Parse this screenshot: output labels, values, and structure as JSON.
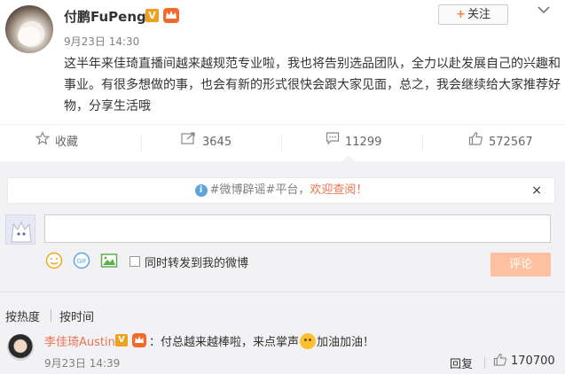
{
  "post": {
    "author": "付鹏FuPeng",
    "verified_badge": "V",
    "follow_label": "关注",
    "follow_plus": "+",
    "time": "9月23日 14:30",
    "content": "这半年来佳琦直播间越来越规范专业啦，我也将告别选品团队，全力以赴发展自己的兴趣和事业。有很多想做的事，也会有新的形式很快会跟大家见面，总之，我会继续给大家推荐好物，分享生活哦"
  },
  "actions": {
    "favorite": "收藏",
    "repost_count": "3645",
    "comment_count": "11299",
    "like_count": "572567"
  },
  "comment_box": {
    "notice_text": "#微博辟谣#平台，",
    "notice_link": "欢迎查阅！",
    "notice_close": "×",
    "repost_label": "同时转发到我的微博",
    "submit_label": "评论"
  },
  "sort": {
    "hot": "按热度",
    "time": "按时间"
  },
  "comments": [
    {
      "author": "李佳琦Austin",
      "verified_badge": "V",
      "text_before": "：付总越来越棒啦，来点掌声",
      "text_after": "加油加油！",
      "time": "9月23日 14:39",
      "reply_label": "回复",
      "like_count": "170700"
    }
  ],
  "colors": {
    "accent": "#eb7350",
    "follow_plus": "#ff8140",
    "submit_disabled": "#ffc09f",
    "verified": "#f0a020",
    "info": "#5fa5dd"
  }
}
